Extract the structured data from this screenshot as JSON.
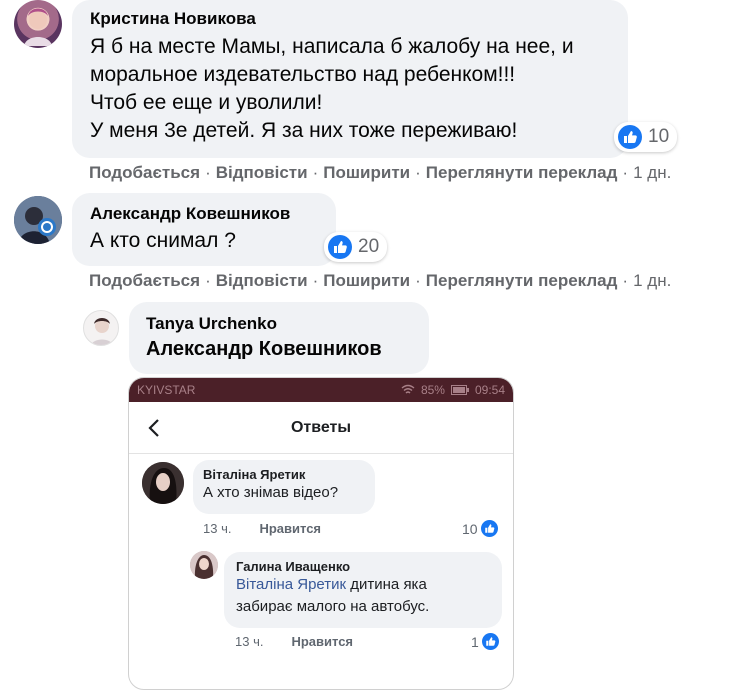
{
  "comments": [
    {
      "author": "Кристина Новикова",
      "lines": [
        "Я б на месте Мамы, написала б жалобу на нее, и",
        "моральное издевательство над ребенком!!!",
        "Чтоб ее еще и уволили!",
        "У меня 3е детей. Я за них тоже переживаю!"
      ],
      "reaction_count": "10",
      "actions": [
        "Подобається",
        "Відповісти",
        "Поширити",
        "Переглянути переклад",
        "1 дн."
      ]
    },
    {
      "author": "Александр Ковешников",
      "lines": [
        "А кто снимал ?"
      ],
      "reaction_count": "20",
      "actions": [
        "Подобається",
        "Відповісти",
        "Поширити",
        "Переглянути переклад",
        "1 дн."
      ]
    }
  ],
  "reply": {
    "author": "Tanya Urchenko",
    "mention": "Александр Ковешников"
  },
  "screenshot": {
    "status": {
      "carrier": "KYIVSTAR",
      "right": "85%",
      "time": "09:54"
    },
    "header_title": "Ответы",
    "comments": [
      {
        "author": "Віталіна Яретик",
        "text": "А хто знімав відео?",
        "time": "13 ч.",
        "like_label": "Нравится",
        "count": "10"
      },
      {
        "author": "Галина Иващенко",
        "mention": "Віталіна Яретик",
        "text_1": "дитина яка",
        "text_2": "забирає малого на автобус.",
        "time": "13 ч.",
        "like_label": "Нравится",
        "count": "1"
      }
    ]
  },
  "colors": {
    "bubble": "#f0f2f5",
    "like_blue": "#1877f2",
    "meta_grey": "#65676b",
    "mention_blue": "#385898",
    "statusbar": "#4b2028"
  },
  "icons": [
    "like-icon",
    "back-arrow-icon",
    "wifi-icon",
    "battery-icon"
  ]
}
